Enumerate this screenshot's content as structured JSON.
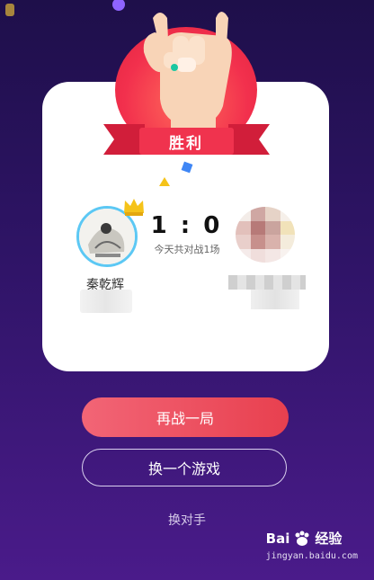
{
  "result_badge": {
    "label": "胜利",
    "color": "#f0334e"
  },
  "player_left": {
    "name": "秦乾辉",
    "crown_icon": "crown-icon",
    "border_color": "#5cc8f4"
  },
  "player_right": {
    "name": "",
    "avatar": "blurred-avatar"
  },
  "score": {
    "value": "1 : 0",
    "subtitle": "今天共对战1场"
  },
  "buttons": {
    "rematch": "再战一局",
    "switch_game": "换一个游戏",
    "change_opponent": "换对手"
  },
  "watermark": {
    "brand": "Bai",
    "brand_suffix": "经验",
    "url": "jingyan.baidu.com"
  },
  "colors": {
    "accent": "#e8404f",
    "background": "#2f1467"
  }
}
